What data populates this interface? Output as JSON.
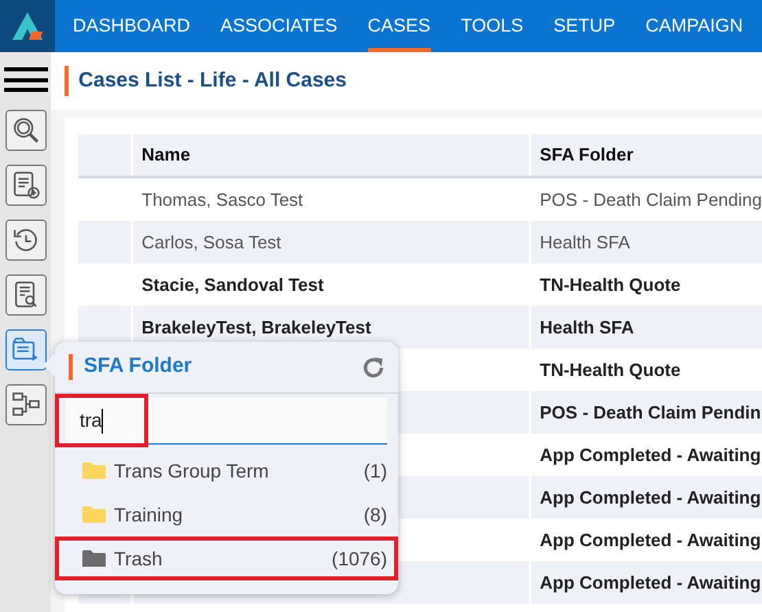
{
  "nav": {
    "tabs": [
      {
        "label": "DASHBOARD",
        "selected": false
      },
      {
        "label": "ASSOCIATES",
        "selected": false
      },
      {
        "label": "CASES",
        "selected": true
      },
      {
        "label": "TOOLS",
        "selected": false
      },
      {
        "label": "SETUP",
        "selected": false
      },
      {
        "label": "CAMPAIGN",
        "selected": false
      }
    ]
  },
  "sidebar": {
    "items": [
      {
        "kind": "search",
        "selected": false
      },
      {
        "kind": "add",
        "selected": false
      },
      {
        "kind": "history",
        "selected": false
      },
      {
        "kind": "report",
        "selected": false
      },
      {
        "kind": "folder",
        "selected": true
      },
      {
        "kind": "flow",
        "selected": false
      }
    ]
  },
  "page_title": "Cases List - Life - All Cases",
  "table": {
    "columns": [
      "Name",
      "SFA Folder"
    ],
    "rows": [
      {
        "name": "Thomas, Sasco Test",
        "sfa_folder": "POS - Death Claim Pending",
        "unread": false
      },
      {
        "name": "Carlos, Sosa Test",
        "sfa_folder": "Health SFA",
        "unread": false
      },
      {
        "name": "Stacie, Sandoval Test",
        "sfa_folder": "TN-Health Quote",
        "unread": true
      },
      {
        "name": "BrakeleyTest, BrakeleyTest",
        "sfa_folder": "Health SFA",
        "unread": true
      },
      {
        "sfa_folder": "TN-Health Quote",
        "unread": true
      },
      {
        "sfa_folder": "POS - Death Claim Pendin",
        "unread": true
      },
      {
        "sfa_folder": "App Completed - Awaiting",
        "unread": true
      },
      {
        "sfa_folder": "App Completed - Awaiting",
        "unread": true
      },
      {
        "sfa_folder": "App Completed - Awaiting",
        "unread": true
      },
      {
        "sfa_folder": "App Completed - Awaiting",
        "unread": true
      }
    ]
  },
  "folder_popup": {
    "title": "SFA Folder",
    "search": {
      "value": "tra",
      "highlighted": true
    },
    "items": [
      {
        "label": "Trans Group Term",
        "count": "(1)",
        "color": "#fcd65c",
        "highlighted": false
      },
      {
        "label": "Training",
        "count": "(8)",
        "color": "#fcd65c",
        "highlighted": false
      },
      {
        "label": "Trash",
        "count": "(1076)",
        "color": "#6b6b6b",
        "highlighted": true
      }
    ]
  }
}
